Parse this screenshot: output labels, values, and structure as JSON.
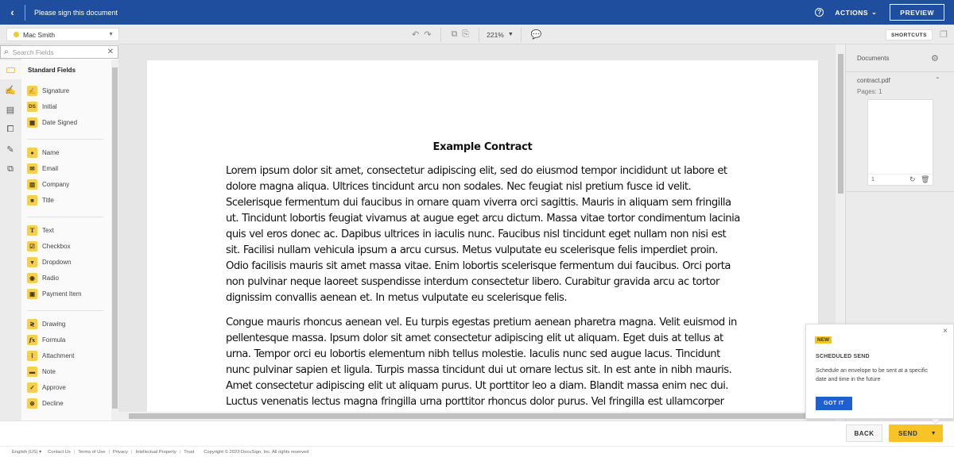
{
  "header": {
    "title": "Please sign this document",
    "back_icon": "chevron-left-icon",
    "help_icon": "help-circle-icon",
    "actions_label": "ACTIONS",
    "preview_label": "PREVIEW"
  },
  "toolbar": {
    "recipient": "Mac Smith",
    "recipient_color": "#f0c93a",
    "undo_icon": "undo-icon",
    "redo_icon": "redo-icon",
    "copy_icon": "copy-icon",
    "paste_icon": "paste-icon",
    "zoom_level": "221%",
    "comment_icon": "add-comment-icon",
    "shortcuts_label": "SHORTCUTS"
  },
  "search": {
    "placeholder": "Search Fields"
  },
  "fields_panel": {
    "heading": "Standard Fields",
    "groups": [
      [
        {
          "label": "Signature",
          "icon": "signature-icon"
        },
        {
          "label": "Initial",
          "icon": "initial-icon"
        },
        {
          "label": "Date Signed",
          "icon": "calendar-icon"
        }
      ],
      [
        {
          "label": "Name",
          "icon": "person-icon"
        },
        {
          "label": "Email",
          "icon": "email-icon"
        },
        {
          "label": "Company",
          "icon": "building-icon"
        },
        {
          "label": "Title",
          "icon": "briefcase-icon"
        }
      ],
      [
        {
          "label": "Text",
          "icon": "text-icon"
        },
        {
          "label": "Checkbox",
          "icon": "checkbox-icon"
        },
        {
          "label": "Dropdown",
          "icon": "dropdown-icon"
        },
        {
          "label": "Radio",
          "icon": "radio-icon"
        },
        {
          "label": "Payment Item",
          "icon": "payment-icon"
        }
      ],
      [
        {
          "label": "Drawing",
          "icon": "drawing-icon"
        },
        {
          "label": "Formula",
          "icon": "formula-icon"
        },
        {
          "label": "Attachment",
          "icon": "paperclip-icon"
        },
        {
          "label": "Note",
          "icon": "note-icon"
        },
        {
          "label": "Approve",
          "icon": "approve-icon"
        },
        {
          "label": "Decline",
          "icon": "decline-icon"
        }
      ]
    ]
  },
  "document": {
    "title": "Example Contract",
    "paragraphs": [
      "Lorem ipsum dolor sit amet, consectetur adipiscing elit, sed do eiusmod tempor incididunt ut labore et dolore magna aliqua. Ultrices tincidunt arcu non sodales. Nec feugiat nisl pretium fusce id velit. Scelerisque fermentum dui faucibus in ornare quam viverra orci sagittis. Mauris in aliquam sem fringilla ut. Tincidunt lobortis feugiat vivamus at augue eget arcu dictum. Massa vitae tortor condimentum lacinia quis vel eros donec ac. Dapibus ultrices in iaculis nunc. Faucibus nisl tincidunt eget nullam non nisi est sit. Facilisi nullam vehicula ipsum a arcu cursus. Metus vulputate eu scelerisque felis imperdiet proin. Odio facilisis mauris sit amet massa vitae. Enim lobortis scelerisque fermentum dui faucibus. Orci porta non pulvinar neque laoreet suspendisse interdum consectetur libero. Curabitur gravida arcu ac tortor dignissim convallis aenean et. In metus vulputate eu scelerisque felis.",
      "Congue mauris rhoncus aenean vel. Eu turpis egestas pretium aenean pharetra magna. Velit euismod in pellentesque massa. Ipsum dolor sit amet consectetur adipiscing elit ut aliquam. Eget duis at tellus at urna. Tempor orci eu lobortis elementum nibh tellus molestie. Iaculis nunc sed augue lacus. Tincidunt nunc pulvinar sapien et ligula. Turpis massa tincidunt dui ut ornare lectus sit. In est ante in nibh mauris. Amet consectetur adipiscing elit ut aliquam purus. Ut porttitor leo a diam. Blandit massa enim nec dui. Luctus venenatis lectus magna fringilla urna porttitor rhoncus dolor purus. Vel fringilla est ullamcorper"
    ]
  },
  "documents_panel": {
    "heading": "Documents",
    "file_name": "contract.pdf",
    "pages_label": "Pages: 1",
    "page_number": "1"
  },
  "popover": {
    "badge": "NEW",
    "title": "SCHEDULED SEND",
    "body": "Schedule an envelope to be sent at a specific date and time in the future",
    "button": "GOT IT",
    "close": "×"
  },
  "actions": {
    "back_label": "BACK",
    "send_label": "SEND"
  },
  "footer": {
    "language": "English (US)",
    "links": [
      "Contact Us",
      "Terms of Use",
      "Privacy",
      "Intellectual Property",
      "Trust"
    ],
    "copyright": "Copyright © 2023 DocuSign, Inc. All rights reserved"
  }
}
